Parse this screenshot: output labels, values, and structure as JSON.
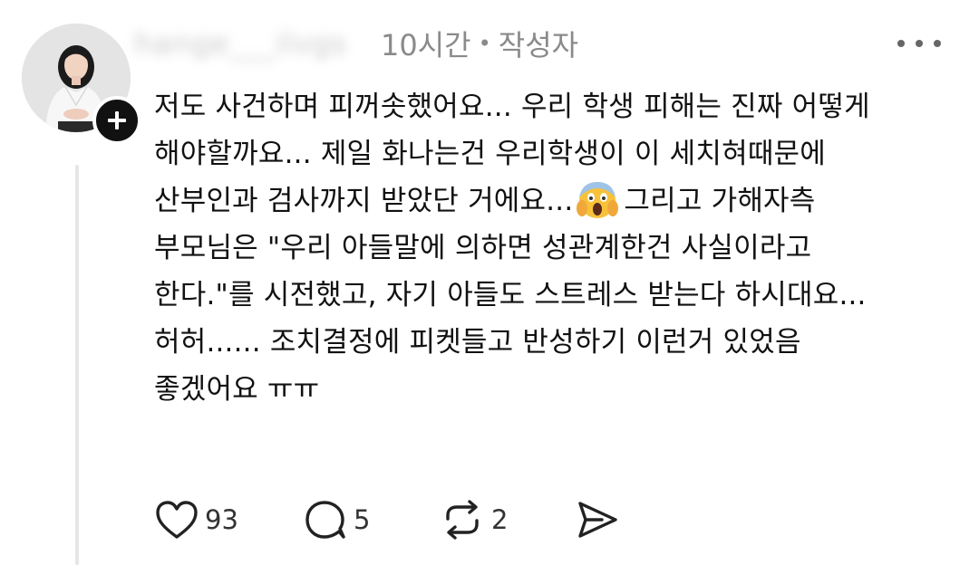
{
  "post": {
    "author": {
      "username": "hange___ilvgs",
      "has_follow_button": true
    },
    "timestamp": "10시간",
    "separator": "•",
    "author_tag": "작성자",
    "more_icon": "more-horizontal-icon",
    "body_lines": [
      "저도 사건하며 피꺼솟했어요... 우리 학생 피해는 진짜 어떻게",
      "해야할까요... 제일 화나는건 우리학생이 이 세치혀때문에",
      "산부인과 검사까지 받았단 거에요...",
      "그리고 가해자측",
      "부모님은 \"우리 아들말에 의하면 성관계한건 사실이라고",
      "한다.\"를 시전했고, 자기 아들도 스트레스 받는다 하시대요...",
      "허허...... 조치결정에 피켓들고 반성하기 이런거 있었음",
      "좋겠어요 ㅠㅠ"
    ],
    "emoji": "face-screaming-in-fear",
    "actions": {
      "like_count": "93",
      "reply_count": "5",
      "repost_count": "2"
    }
  }
}
